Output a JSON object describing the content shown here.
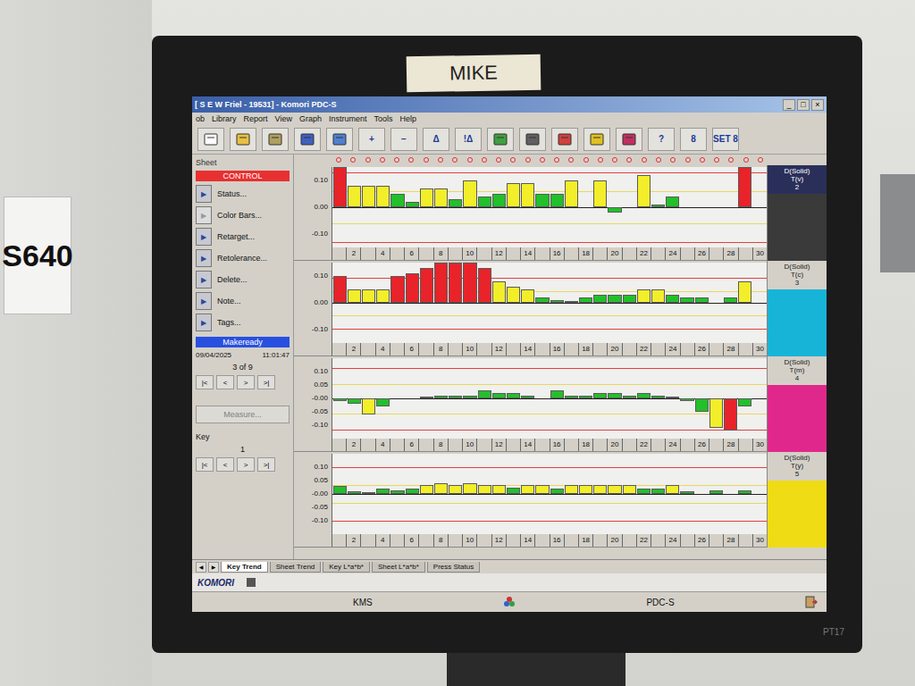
{
  "photo": {
    "tape_label": "MIKE",
    "wall_sign": "S640",
    "monitor_model": "PT17"
  },
  "window": {
    "title": "[ S E W Friel - 19531] - Komori PDC-S",
    "controls": [
      "_",
      "□",
      "×"
    ]
  },
  "menu": [
    "ob",
    "Library",
    "Report",
    "View",
    "Graph",
    "Instrument",
    "Tools",
    "Help"
  ],
  "toolbar": [
    {
      "label": ""
    },
    {
      "label": ""
    },
    {
      "label": ""
    },
    {
      "label": ""
    },
    {
      "label": ""
    },
    {
      "label": "+"
    },
    {
      "label": "−"
    },
    {
      "label": "Δ"
    },
    {
      "label": "!Δ"
    },
    {
      "label": ""
    },
    {
      "label": ""
    },
    {
      "label": ""
    },
    {
      "label": ""
    },
    {
      "label": ""
    },
    {
      "label": "?"
    },
    {
      "label": "8"
    },
    {
      "label": "SET 8"
    }
  ],
  "sidebar": {
    "section": "Sheet",
    "mode": "CONTROL",
    "arrow": "▶",
    "actions": [
      {
        "label": "Status...",
        "disabled": false
      },
      {
        "label": "Color Bars...",
        "disabled": true
      },
      {
        "label": "Retarget...",
        "disabled": false
      },
      {
        "label": "Retolerance...",
        "disabled": false
      },
      {
        "label": "Delete...",
        "disabled": false
      },
      {
        "label": "Note...",
        "disabled": false
      },
      {
        "label": "Tags...",
        "disabled": false
      }
    ],
    "job": {
      "label": "Makeready",
      "date": "09/04/2025",
      "time": "11:01:47",
      "position": "3 of 9"
    },
    "nav": [
      "|<",
      "<",
      ">",
      ">|"
    ],
    "measure": {
      "label": "Measure...",
      "disabled": true
    },
    "key": {
      "label": "Key",
      "value": "1"
    }
  },
  "chart": {
    "x_ticks": [
      "2",
      "4",
      "6",
      "8",
      "10",
      "12",
      "14",
      "16",
      "18",
      "20",
      "22",
      "24",
      "26",
      "28",
      "30"
    ],
    "series": [
      {
        "name": "D(Solid)",
        "sub": "T(v)",
        "number": "2",
        "color": "#3a3a3a",
        "selected": true,
        "ticks": [
          "0.10",
          "0.00",
          "-0.10"
        ],
        "warn": 0.06,
        "fail": 0.13,
        "values": [
          0.16,
          0.08,
          0.08,
          0.08,
          0.05,
          0.02,
          0.07,
          0.07,
          0.03,
          0.1,
          0.04,
          0.05,
          0.09,
          0.09,
          0.05,
          0.05,
          0.1,
          0.0,
          0.1,
          -0.02,
          0.0,
          0.12,
          0.01,
          0.04,
          0.0,
          0.0,
          0.0,
          0.0,
          0.15,
          0.0
        ]
      },
      {
        "name": "D(Solid)",
        "sub": "T(c)",
        "number": "3",
        "color": "#18b4d8",
        "selected": false,
        "ticks": [
          "0.10",
          "0.00",
          "-0.10"
        ],
        "warn": 0.045,
        "fail": 0.095,
        "values": [
          0.1,
          0.05,
          0.05,
          0.05,
          0.1,
          0.11,
          0.13,
          0.15,
          0.17,
          0.17,
          0.13,
          0.08,
          0.06,
          0.05,
          0.02,
          0.01,
          0.005,
          0.02,
          0.03,
          0.03,
          0.03,
          0.05,
          0.05,
          0.03,
          0.02,
          0.02,
          0.0,
          0.02,
          0.08,
          0.0
        ]
      },
      {
        "name": "D(Solid)",
        "sub": "T(m)",
        "number": "4",
        "color": "#e0288c",
        "selected": false,
        "ticks": [
          "0.10",
          "0.05",
          "-0.00",
          "-0.05",
          "-0.10"
        ],
        "warn": 0.055,
        "fail": 0.115,
        "values": [
          -0.01,
          -0.02,
          -0.06,
          -0.03,
          0.0,
          0.0,
          0.005,
          0.01,
          0.01,
          0.01,
          0.03,
          0.02,
          0.02,
          0.01,
          0.0,
          0.03,
          0.01,
          0.01,
          0.02,
          0.02,
          0.01,
          0.02,
          0.01,
          0.005,
          -0.01,
          -0.05,
          -0.11,
          -0.12,
          -0.03,
          0.0
        ]
      },
      {
        "name": "D(Solid)",
        "sub": "T(y)",
        "number": "5",
        "color": "#f0dc14",
        "selected": false,
        "ticks": [
          "0.10",
          "0.05",
          "-0.00",
          "-0.05",
          "-0.10"
        ],
        "warn": 0.032,
        "fail": 0.1,
        "values": [
          0.03,
          0.01,
          0.005,
          0.02,
          0.015,
          0.02,
          0.035,
          0.04,
          0.035,
          0.04,
          0.035,
          0.035,
          0.025,
          0.035,
          0.033,
          0.02,
          0.035,
          0.033,
          0.033,
          0.033,
          0.035,
          0.02,
          0.02,
          0.033,
          0.01,
          0.0,
          0.015,
          0.0,
          0.015,
          0.0
        ]
      }
    ]
  },
  "sheet_tabs": {
    "scroll": [
      "◀",
      "▶"
    ],
    "items": [
      {
        "label": "Key Trend",
        "selected": true
      },
      {
        "label": "Sheet Trend",
        "selected": false
      },
      {
        "label": "Key L*a*b*",
        "selected": false
      },
      {
        "label": "Sheet L*a*b*",
        "selected": false
      },
      {
        "label": "Press Status",
        "selected": false
      }
    ]
  },
  "status_bar": {
    "brand": "KOMORI"
  },
  "taskbar": {
    "left": "KMS",
    "right": "PDC-S"
  }
}
